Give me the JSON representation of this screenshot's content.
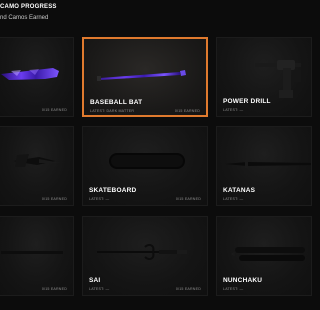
{
  "header": {
    "title": "CAMO PROGRESS",
    "subtitle": "nd Camos Earned"
  },
  "weapons": [
    {
      "name": "",
      "latest": "",
      "earned": "0/15 EARNED",
      "icon": "purple-camo-weapon-icon"
    },
    {
      "name": "BASEBALL BAT",
      "latest": "LATEST: DARK MATTER",
      "earned": "0/15 EARNED",
      "icon": "baseball-bat-icon",
      "selected": true
    },
    {
      "name": "POWER DRILL",
      "latest": "LATEST: —",
      "earned": "",
      "icon": "power-drill-icon"
    },
    {
      "name": "",
      "latest": "",
      "earned": "0/15 EARNED",
      "icon": "knife-icon"
    },
    {
      "name": "SKATEBOARD",
      "latest": "LATEST: —",
      "earned": "0/15 EARNED",
      "icon": "skateboard-icon"
    },
    {
      "name": "KATANAS",
      "latest": "LATEST: —",
      "earned": "",
      "icon": "katana-icon"
    },
    {
      "name": "",
      "latest": "",
      "earned": "0/15 EARNED",
      "icon": "staff-icon"
    },
    {
      "name": "SAI",
      "latest": "LATEST: —",
      "earned": "0/15 EARNED",
      "icon": "sai-icon"
    },
    {
      "name": "NUNCHAKU",
      "latest": "LATEST: —",
      "earned": "",
      "icon": "nunchaku-icon"
    }
  ],
  "colors": {
    "selected_border": "#e07a2e",
    "camo_purple": "#5b2bd1"
  }
}
